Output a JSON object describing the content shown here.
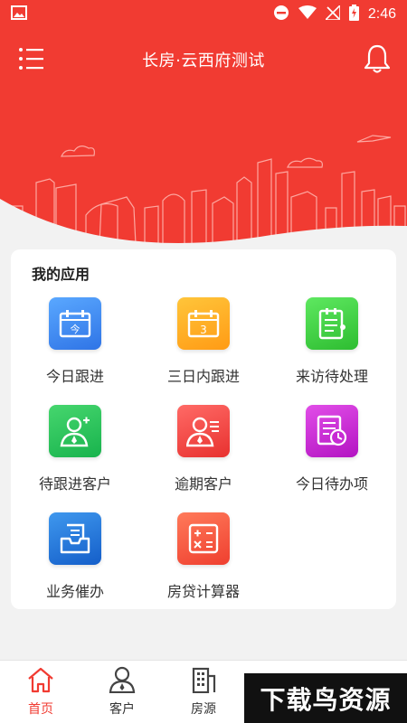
{
  "status_bar": {
    "time": "2:46"
  },
  "header": {
    "title": "长房·云西府测试"
  },
  "apps": {
    "title": "我的应用",
    "items": [
      {
        "label": "今日跟进",
        "icon": "calendar-today-icon",
        "icon_text": "今",
        "color": "#3d8ef5"
      },
      {
        "label": "三日内跟进",
        "icon": "calendar-three-days-icon",
        "icon_text": "3",
        "color": "#ffab22"
      },
      {
        "label": "来访待处理",
        "icon": "clipboard-list-icon",
        "color": "#3dcf3f"
      },
      {
        "label": "待跟进客户",
        "icon": "customer-pending-icon",
        "color": "#25c256"
      },
      {
        "label": "逾期客户",
        "icon": "customer-overdue-icon",
        "color": "#f04540"
      },
      {
        "label": "今日待办项",
        "icon": "todo-clock-icon",
        "color": "#c72bd4"
      },
      {
        "label": "业务催办",
        "icon": "inbox-tray-icon",
        "color": "#2576dc"
      },
      {
        "label": "房贷计算器",
        "icon": "calculator-icon",
        "color": "#f25a42"
      }
    ]
  },
  "bottom_nav": {
    "items": [
      {
        "label": "首页",
        "icon": "home-icon"
      },
      {
        "label": "客户",
        "icon": "person-icon"
      },
      {
        "label": "房源",
        "icon": "building-icon"
      }
    ]
  },
  "watermark": {
    "text": "下载鸟资源"
  },
  "colors": {
    "primary": "#f13b32",
    "accent_red": "#f13b32"
  }
}
